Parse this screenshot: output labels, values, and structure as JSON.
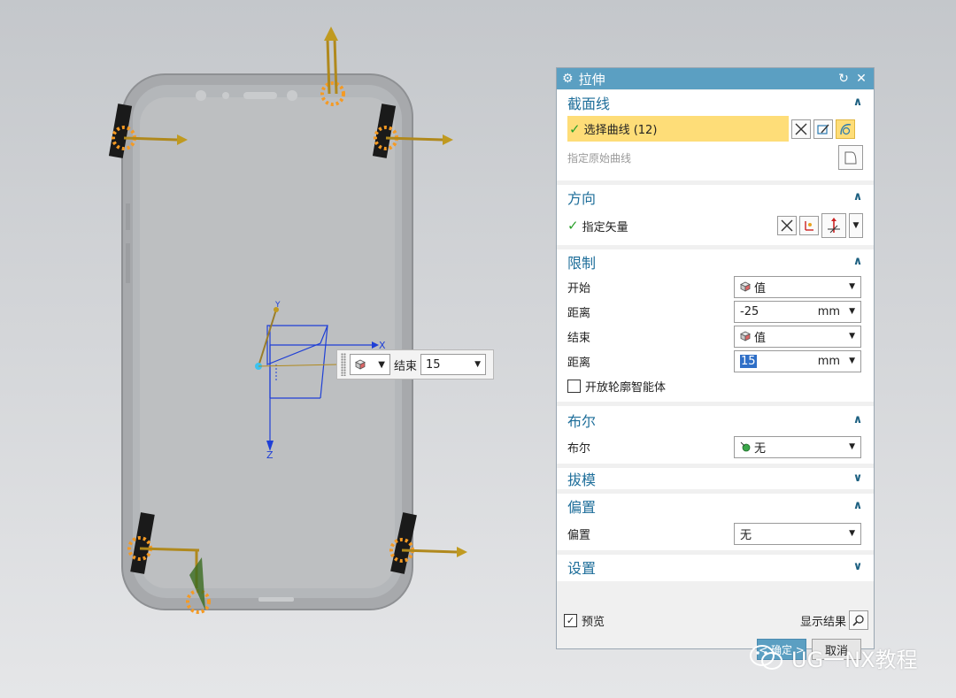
{
  "dialog": {
    "title": "拉伸",
    "icons": {
      "title": "gear-icon",
      "reset": "reset-icon",
      "close": "close-icon"
    }
  },
  "section_curve": {
    "title": "截面线",
    "select_curve": "选择曲线 (12)",
    "specify_original": "指定原始曲线"
  },
  "direction": {
    "title": "方向",
    "specify_vector": "指定矢量"
  },
  "limits": {
    "title": "限制",
    "start_label": "开始",
    "start_value": "值",
    "start_distance_label": "距离",
    "start_distance": "-25",
    "start_unit": "mm",
    "end_label": "结束",
    "end_value": "值",
    "end_distance_label": "距离",
    "end_distance": "15",
    "end_unit": "mm",
    "open_profile": "开放轮廓智能体"
  },
  "boolean": {
    "title": "布尔",
    "label": "布尔",
    "value": "无"
  },
  "draft": {
    "title": "拔模"
  },
  "offset": {
    "title": "偏置",
    "label": "偏置",
    "value": "无"
  },
  "settings": {
    "title": "设置"
  },
  "footer": {
    "preview": "预览",
    "preview_checked": true,
    "show_result": "显示结果",
    "ok": "< 确定 >",
    "cancel": "取消"
  },
  "dynamic_input": {
    "label": "结束",
    "value": "15"
  },
  "axes": {
    "x": "X",
    "y": "Y",
    "z": "Z"
  },
  "watermark": "UG一NX教程",
  "colors": {
    "titlebar": "#5b9fc2",
    "section_title": "#1e6e9a",
    "selection_highlight": "#fedd78",
    "handle_orange": "#f59a23",
    "csys_blue": "#1f3fd6"
  }
}
